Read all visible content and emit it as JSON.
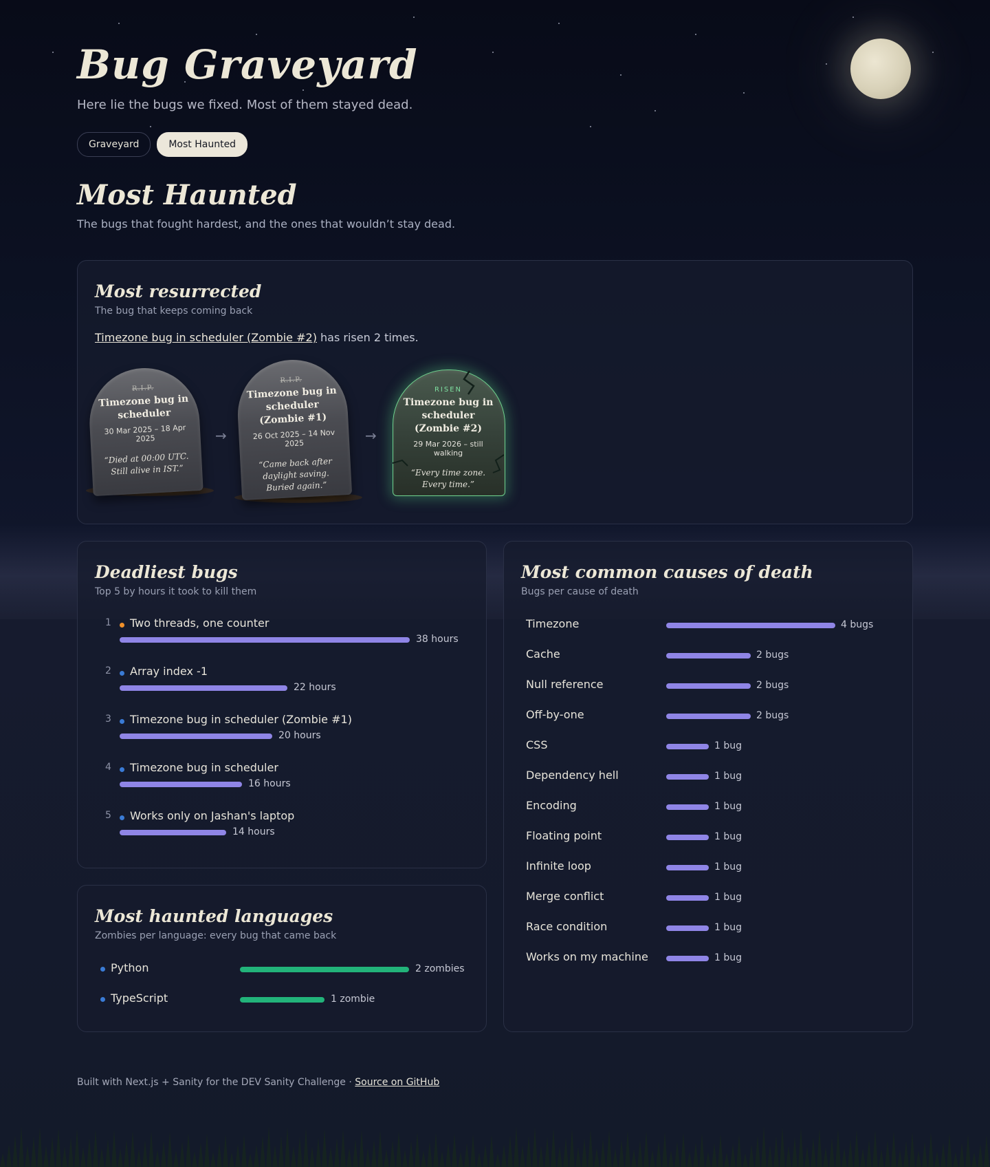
{
  "header": {
    "title": "Bug Graveyard",
    "subtitle": "Here lie the bugs we fixed. Most of them stayed dead.",
    "tabs": [
      {
        "label": "Graveyard",
        "active": false
      },
      {
        "label": "Most Haunted",
        "active": true
      }
    ]
  },
  "page": {
    "title": "Most Haunted",
    "subtitle": "The bugs that fought hardest, and the ones that wouldn’t stay dead."
  },
  "resurrected": {
    "title": "Most resurrected",
    "caption": "The bug that keeps coming back",
    "link": "Timezone bug in scheduler (Zombie #2)",
    "suffix": " has risen 2 times.",
    "arrow": "→",
    "stones": [
      {
        "marker": "R.I.P.",
        "name": "Timezone bug in scheduler",
        "dates": "30 Mar 2025 – 18 Apr 2025",
        "quote": "“Died at 00:00 UTC. Still alive in IST.”"
      },
      {
        "marker": "R.I.P.",
        "name": "Timezone bug in scheduler (Zombie #1)",
        "dates": "26 Oct 2025 – 14 Nov 2025",
        "quote": "“Came back after daylight saving. Buried again.”"
      },
      {
        "marker": "RISEN",
        "name": "Timezone bug in scheduler (Zombie #2)",
        "dates": "29 Mar 2026 – still walking",
        "quote": "“Every time zone. Every time.”"
      }
    ]
  },
  "deadliest": {
    "title": "Deadliest bugs",
    "caption": "Top 5 by hours it took to kill them",
    "max": 38,
    "items": [
      {
        "rank": "1",
        "name": "Two threads, one counter",
        "hours": 38,
        "label": "38 hours",
        "dot": "#f0902a"
      },
      {
        "rank": "2",
        "name": "Array index -1",
        "hours": 22,
        "label": "22 hours",
        "dot": "#3a7bd5"
      },
      {
        "rank": "3",
        "name": "Timezone bug in scheduler (Zombie #1)",
        "hours": 20,
        "label": "20 hours",
        "dot": "#3a7bd5"
      },
      {
        "rank": "4",
        "name": "Timezone bug in scheduler",
        "hours": 16,
        "label": "16 hours",
        "dot": "#3a7bd5"
      },
      {
        "rank": "5",
        "name": "Works only on Jashan's laptop",
        "hours": 14,
        "label": "14 hours",
        "dot": "#3a7bd5"
      }
    ]
  },
  "languages": {
    "title": "Most haunted languages",
    "caption": "Zombies per language: every bug that came back",
    "max": 2,
    "items": [
      {
        "name": "Python",
        "count": 2,
        "label": "2 zombies",
        "dot": "#3a7bd5"
      },
      {
        "name": "TypeScript",
        "count": 1,
        "label": "1 zombie",
        "dot": "#3a7bd5"
      }
    ]
  },
  "causes": {
    "title": "Most common causes of death",
    "caption": "Bugs per cause of death",
    "max": 4,
    "items": [
      {
        "name": "Timezone",
        "count": 4,
        "label": "4 bugs"
      },
      {
        "name": "Cache",
        "count": 2,
        "label": "2 bugs"
      },
      {
        "name": "Null reference",
        "count": 2,
        "label": "2 bugs"
      },
      {
        "name": "Off-by-one",
        "count": 2,
        "label": "2 bugs"
      },
      {
        "name": "CSS",
        "count": 1,
        "label": "1 bug"
      },
      {
        "name": "Dependency hell",
        "count": 1,
        "label": "1 bug"
      },
      {
        "name": "Encoding",
        "count": 1,
        "label": "1 bug"
      },
      {
        "name": "Floating point",
        "count": 1,
        "label": "1 bug"
      },
      {
        "name": "Infinite loop",
        "count": 1,
        "label": "1 bug"
      },
      {
        "name": "Merge conflict",
        "count": 1,
        "label": "1 bug"
      },
      {
        "name": "Race condition",
        "count": 1,
        "label": "1 bug"
      },
      {
        "name": "Works on my machine",
        "count": 1,
        "label": "1 bug"
      }
    ]
  },
  "footer": {
    "text": "Built with Next.js + Sanity for the DEV Sanity Challenge · ",
    "link": "Source on GitHub"
  },
  "colors": {
    "accent_bar": "#8f85e6",
    "language_bar": "#22b37a",
    "risen": "#7ee0a0"
  }
}
